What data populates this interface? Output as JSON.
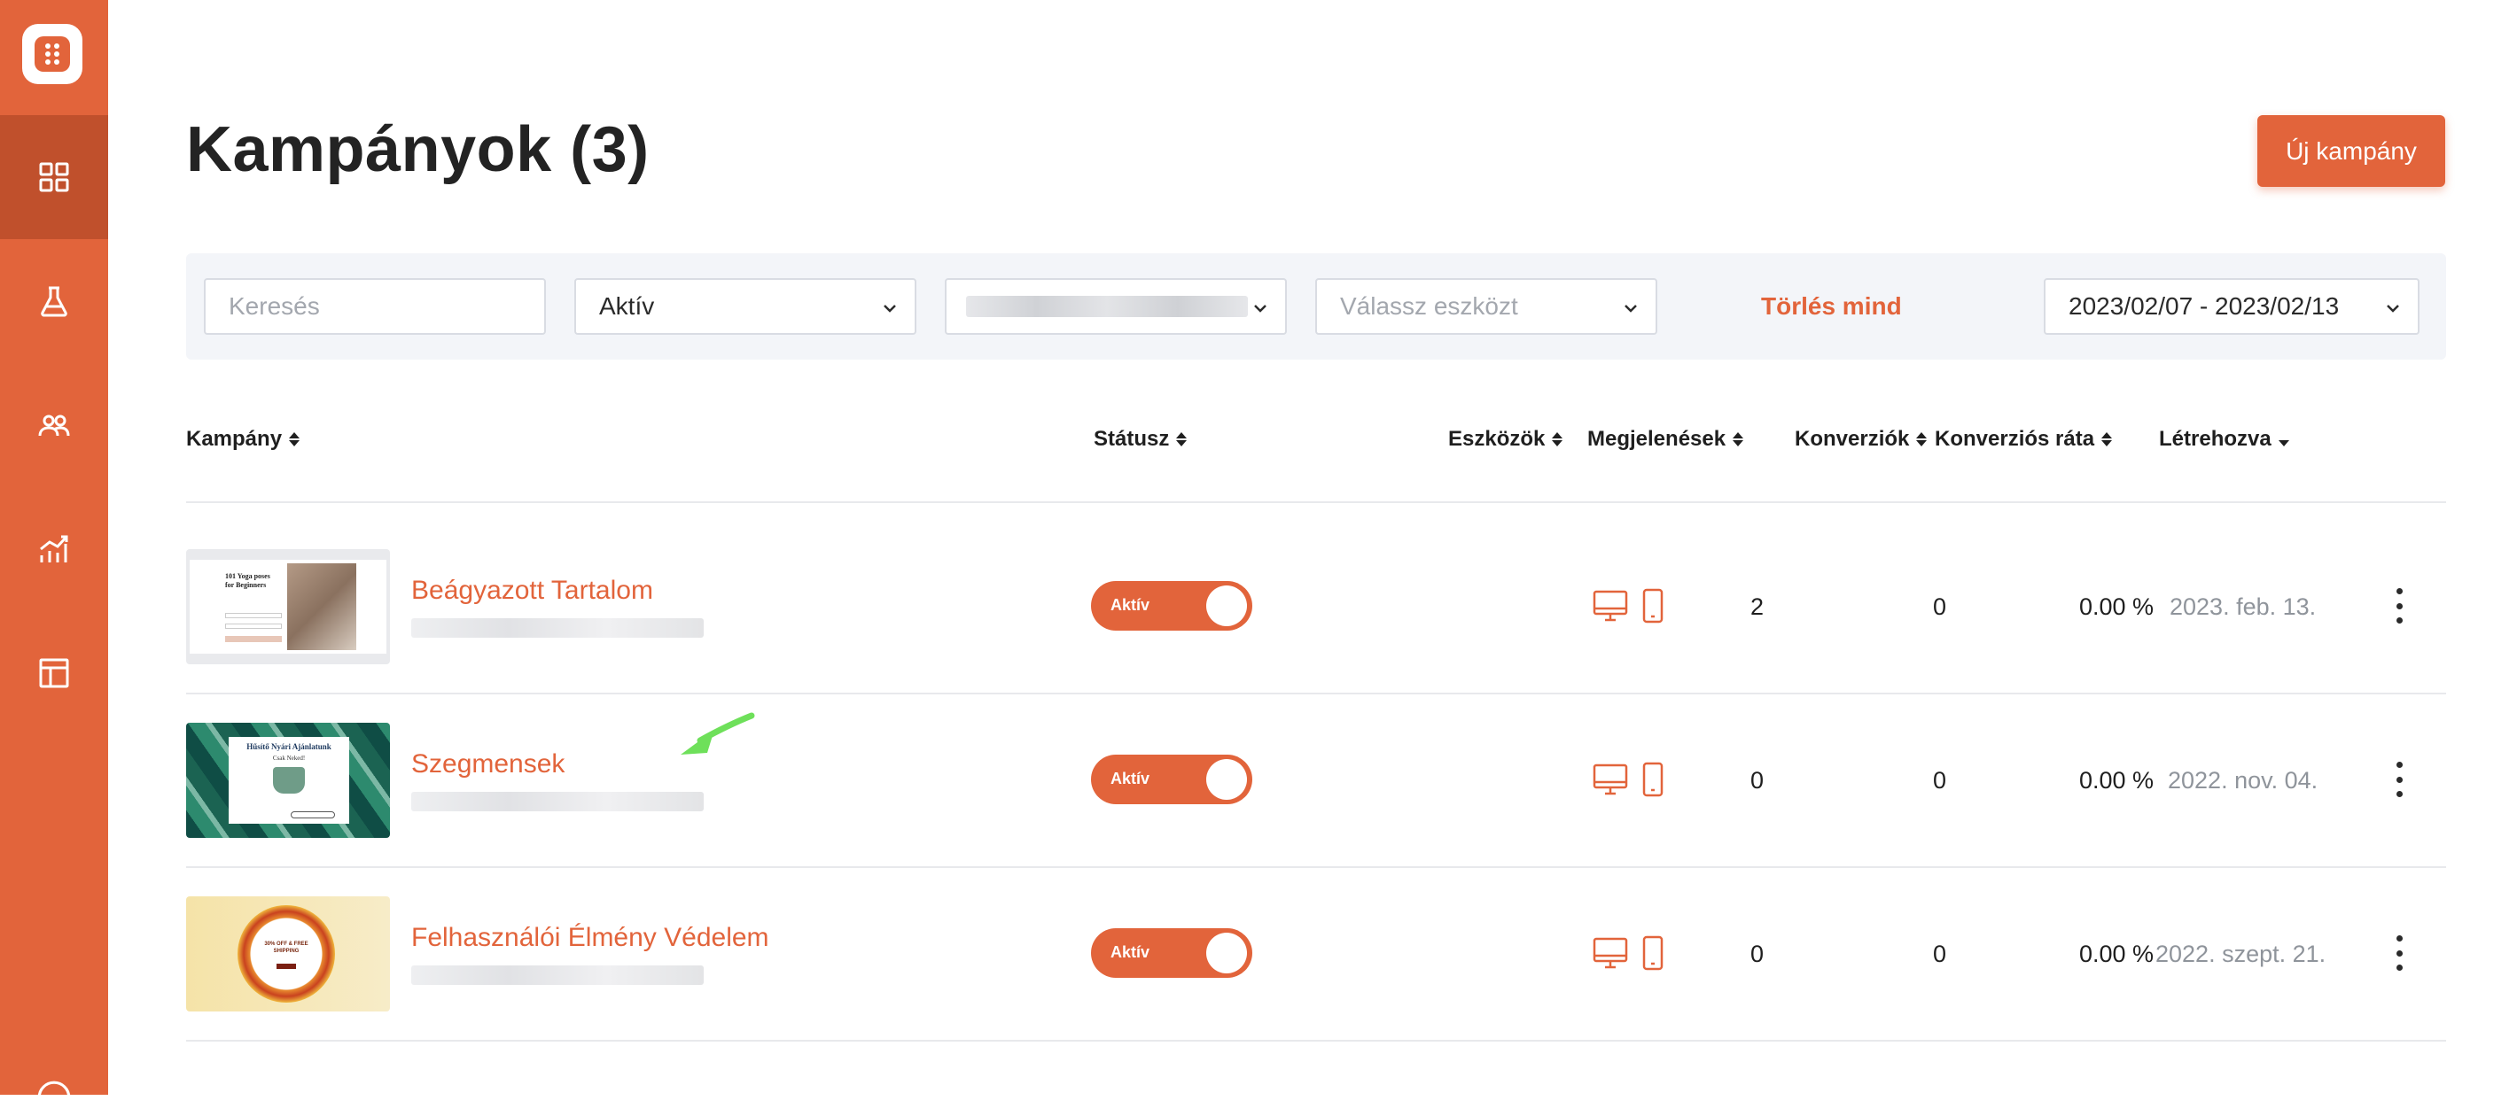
{
  "sidebar": {
    "logo_icon": "dots-logo-icon",
    "items": [
      {
        "icon": "dashboard-grid-icon",
        "active": true
      },
      {
        "icon": "flask-icon",
        "active": false
      },
      {
        "icon": "users-icon",
        "active": false
      },
      {
        "icon": "analytics-chart-icon",
        "active": false
      },
      {
        "icon": "layout-template-icon",
        "active": false
      }
    ]
  },
  "header": {
    "title": "Kampányok (3)",
    "new_button": "Új kampány"
  },
  "filters": {
    "search_placeholder": "Keresés",
    "status_value": "Aktív",
    "device_placeholder": "Válassz eszközt",
    "clear_all": "Törlés mind",
    "date_range": "2023/02/07 - 2023/02/13"
  },
  "table": {
    "columns": {
      "campaign": "Kampány",
      "status": "Státusz",
      "devices": "Eszközök",
      "impressions": "Megjelenések",
      "conversions": "Konverziók",
      "conversion_rate": "Konverziós ráta",
      "created": "Létrehozva"
    },
    "rows": [
      {
        "name": "Beágyazott Tartalom",
        "status": "Aktív",
        "impressions": "2",
        "conversions": "0",
        "rate": "0.00 %",
        "created": "2023. feb. 13."
      },
      {
        "name": "Szegmensek",
        "status": "Aktív",
        "impressions": "0",
        "conversions": "0",
        "rate": "0.00 %",
        "created": "2022. nov. 04."
      },
      {
        "name": "Felhasználói Élmény Védelem",
        "status": "Aktív",
        "impressions": "0",
        "conversions": "0",
        "rate": "0.00 %",
        "created": "2022. szept. 21."
      }
    ]
  },
  "thumbnails": {
    "row1_heading": "101 Yoga poses for Beginners",
    "row2_heading": "Hűsítő Nyári Ajánlatunk",
    "row2_sub": "Csak Neked!",
    "row3_heading": "30% OFF & FREE SHIPPING"
  },
  "colors": {
    "accent": "#e2643b",
    "accent_dark": "#c0502c",
    "muted": "#8f949b"
  }
}
